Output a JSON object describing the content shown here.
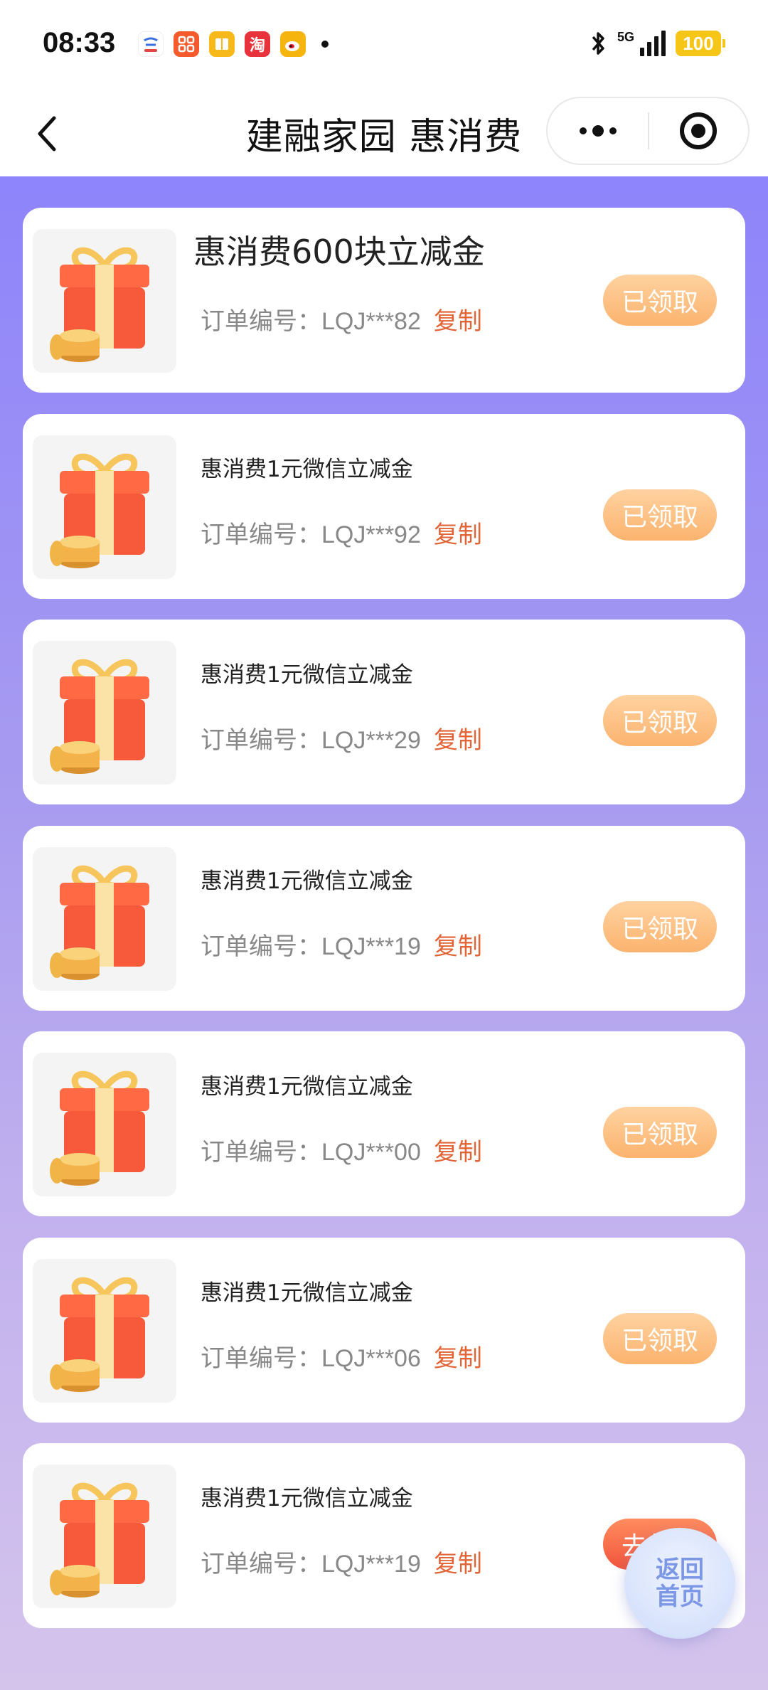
{
  "status_bar": {
    "time": "08:33",
    "network": "5G",
    "battery": "100",
    "notification_icons": [
      "app-icon-1",
      "app-icon-2",
      "app-icon-3",
      "taobao-icon",
      "weibo-icon"
    ],
    "taobao_glyph": "淘"
  },
  "nav": {
    "title": "建融家园 惠消费"
  },
  "cards": [
    {
      "title": "惠消费600块立减金",
      "order_label": "订单编号：",
      "order_no": "LQJ***82",
      "copy_label": "复制",
      "button_label": "已领取",
      "claimed": true
    },
    {
      "title": "惠消费1元微信立减金",
      "order_label": "订单编号：",
      "order_no": "LQJ***92",
      "copy_label": "复制",
      "button_label": "已领取",
      "claimed": true
    },
    {
      "title": "惠消费1元微信立减金",
      "order_label": "订单编号：",
      "order_no": "LQJ***29",
      "copy_label": "复制",
      "button_label": "已领取",
      "claimed": true
    },
    {
      "title": "惠消费1元微信立减金",
      "order_label": "订单编号：",
      "order_no": "LQJ***19",
      "copy_label": "复制",
      "button_label": "已领取",
      "claimed": true
    },
    {
      "title": "惠消费1元微信立减金",
      "order_label": "订单编号：",
      "order_no": "LQJ***00",
      "copy_label": "复制",
      "button_label": "已领取",
      "claimed": true
    },
    {
      "title": "惠消费1元微信立减金",
      "order_label": "订单编号：",
      "order_no": "LQJ***06",
      "copy_label": "复制",
      "button_label": "已领取",
      "claimed": true
    },
    {
      "title": "惠消费1元微信立减金",
      "order_label": "订单编号：",
      "order_no": "LQJ***19",
      "copy_label": "复制",
      "button_label": "去领取",
      "claimed": false
    }
  ],
  "home_button": {
    "label": "返回首页"
  },
  "colors": {
    "accent_orange": "#e26436",
    "claimed_button": "#fbb36e",
    "active_button": "#f0543c",
    "background_top": "#8e84fb",
    "background_bottom": "#d4c4ec"
  }
}
